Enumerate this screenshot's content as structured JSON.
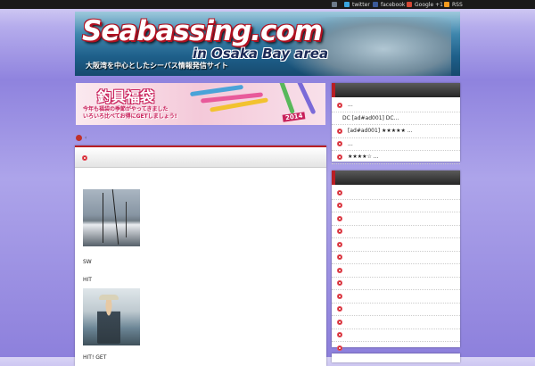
{
  "topbar": {
    "items": [
      {
        "label": "",
        "icon": "home-icon"
      },
      {
        "label": "twitter",
        "icon": "twitter-icon"
      },
      {
        "label": "facebook",
        "icon": "facebook-icon"
      },
      {
        "label": "Google +1",
        "icon": "google-plus-icon"
      },
      {
        "label": "RSS",
        "icon": "rss-icon"
      }
    ]
  },
  "header": {
    "title": "Seabassing.com",
    "subtitle": "in Osaka Bay area",
    "tagline": "大阪湾を中心としたシーバス情報発信サイト"
  },
  "promo": {
    "title": "釣具福袋",
    "line1": "今年も福袋の季節がやってきました",
    "line2": "いろいろ比べてお得にGETしましょう!",
    "year": "2014"
  },
  "breadcrumb": {
    "separator": "‹"
  },
  "post": {
    "text_sw": "SW",
    "text_hit": "HIT",
    "text_hit_get": "HIT! GET"
  },
  "sidebar": {
    "box1_rows": [
      {
        "text": "..."
      },
      {
        "text": "DC        [ad#ad001] DC..."
      },
      {
        "text": "[ad#ad001] ★★★★★ ..."
      },
      {
        "text": "       ..."
      },
      {
        "text": "★★★★☆       ..."
      }
    ],
    "box2_row_count": 13
  },
  "colors": {
    "accent_red": "#b81e24",
    "header_dark": "#262626",
    "background_purple": "#8f83de"
  }
}
